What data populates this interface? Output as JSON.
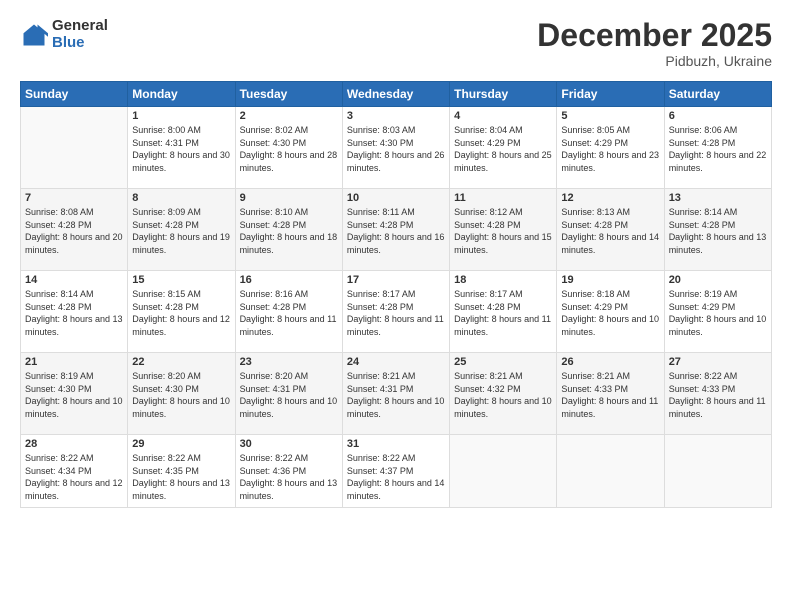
{
  "logo": {
    "general": "General",
    "blue": "Blue"
  },
  "title": "December 2025",
  "subtitle": "Pidbuzh, Ukraine",
  "weekdays": [
    "Sunday",
    "Monday",
    "Tuesday",
    "Wednesday",
    "Thursday",
    "Friday",
    "Saturday"
  ],
  "weeks": [
    [
      {
        "day": "",
        "sunrise": "",
        "sunset": "",
        "daylight": ""
      },
      {
        "day": "1",
        "sunrise": "Sunrise: 8:00 AM",
        "sunset": "Sunset: 4:31 PM",
        "daylight": "Daylight: 8 hours and 30 minutes."
      },
      {
        "day": "2",
        "sunrise": "Sunrise: 8:02 AM",
        "sunset": "Sunset: 4:30 PM",
        "daylight": "Daylight: 8 hours and 28 minutes."
      },
      {
        "day": "3",
        "sunrise": "Sunrise: 8:03 AM",
        "sunset": "Sunset: 4:30 PM",
        "daylight": "Daylight: 8 hours and 26 minutes."
      },
      {
        "day": "4",
        "sunrise": "Sunrise: 8:04 AM",
        "sunset": "Sunset: 4:29 PM",
        "daylight": "Daylight: 8 hours and 25 minutes."
      },
      {
        "day": "5",
        "sunrise": "Sunrise: 8:05 AM",
        "sunset": "Sunset: 4:29 PM",
        "daylight": "Daylight: 8 hours and 23 minutes."
      },
      {
        "day": "6",
        "sunrise": "Sunrise: 8:06 AM",
        "sunset": "Sunset: 4:28 PM",
        "daylight": "Daylight: 8 hours and 22 minutes."
      }
    ],
    [
      {
        "day": "7",
        "sunrise": "Sunrise: 8:08 AM",
        "sunset": "Sunset: 4:28 PM",
        "daylight": "Daylight: 8 hours and 20 minutes."
      },
      {
        "day": "8",
        "sunrise": "Sunrise: 8:09 AM",
        "sunset": "Sunset: 4:28 PM",
        "daylight": "Daylight: 8 hours and 19 minutes."
      },
      {
        "day": "9",
        "sunrise": "Sunrise: 8:10 AM",
        "sunset": "Sunset: 4:28 PM",
        "daylight": "Daylight: 8 hours and 18 minutes."
      },
      {
        "day": "10",
        "sunrise": "Sunrise: 8:11 AM",
        "sunset": "Sunset: 4:28 PM",
        "daylight": "Daylight: 8 hours and 16 minutes."
      },
      {
        "day": "11",
        "sunrise": "Sunrise: 8:12 AM",
        "sunset": "Sunset: 4:28 PM",
        "daylight": "Daylight: 8 hours and 15 minutes."
      },
      {
        "day": "12",
        "sunrise": "Sunrise: 8:13 AM",
        "sunset": "Sunset: 4:28 PM",
        "daylight": "Daylight: 8 hours and 14 minutes."
      },
      {
        "day": "13",
        "sunrise": "Sunrise: 8:14 AM",
        "sunset": "Sunset: 4:28 PM",
        "daylight": "Daylight: 8 hours and 13 minutes."
      }
    ],
    [
      {
        "day": "14",
        "sunrise": "Sunrise: 8:14 AM",
        "sunset": "Sunset: 4:28 PM",
        "daylight": "Daylight: 8 hours and 13 minutes."
      },
      {
        "day": "15",
        "sunrise": "Sunrise: 8:15 AM",
        "sunset": "Sunset: 4:28 PM",
        "daylight": "Daylight: 8 hours and 12 minutes."
      },
      {
        "day": "16",
        "sunrise": "Sunrise: 8:16 AM",
        "sunset": "Sunset: 4:28 PM",
        "daylight": "Daylight: 8 hours and 11 minutes."
      },
      {
        "day": "17",
        "sunrise": "Sunrise: 8:17 AM",
        "sunset": "Sunset: 4:28 PM",
        "daylight": "Daylight: 8 hours and 11 minutes."
      },
      {
        "day": "18",
        "sunrise": "Sunrise: 8:17 AM",
        "sunset": "Sunset: 4:28 PM",
        "daylight": "Daylight: 8 hours and 11 minutes."
      },
      {
        "day": "19",
        "sunrise": "Sunrise: 8:18 AM",
        "sunset": "Sunset: 4:29 PM",
        "daylight": "Daylight: 8 hours and 10 minutes."
      },
      {
        "day": "20",
        "sunrise": "Sunrise: 8:19 AM",
        "sunset": "Sunset: 4:29 PM",
        "daylight": "Daylight: 8 hours and 10 minutes."
      }
    ],
    [
      {
        "day": "21",
        "sunrise": "Sunrise: 8:19 AM",
        "sunset": "Sunset: 4:30 PM",
        "daylight": "Daylight: 8 hours and 10 minutes."
      },
      {
        "day": "22",
        "sunrise": "Sunrise: 8:20 AM",
        "sunset": "Sunset: 4:30 PM",
        "daylight": "Daylight: 8 hours and 10 minutes."
      },
      {
        "day": "23",
        "sunrise": "Sunrise: 8:20 AM",
        "sunset": "Sunset: 4:31 PM",
        "daylight": "Daylight: 8 hours and 10 minutes."
      },
      {
        "day": "24",
        "sunrise": "Sunrise: 8:21 AM",
        "sunset": "Sunset: 4:31 PM",
        "daylight": "Daylight: 8 hours and 10 minutes."
      },
      {
        "day": "25",
        "sunrise": "Sunrise: 8:21 AM",
        "sunset": "Sunset: 4:32 PM",
        "daylight": "Daylight: 8 hours and 10 minutes."
      },
      {
        "day": "26",
        "sunrise": "Sunrise: 8:21 AM",
        "sunset": "Sunset: 4:33 PM",
        "daylight": "Daylight: 8 hours and 11 minutes."
      },
      {
        "day": "27",
        "sunrise": "Sunrise: 8:22 AM",
        "sunset": "Sunset: 4:33 PM",
        "daylight": "Daylight: 8 hours and 11 minutes."
      }
    ],
    [
      {
        "day": "28",
        "sunrise": "Sunrise: 8:22 AM",
        "sunset": "Sunset: 4:34 PM",
        "daylight": "Daylight: 8 hours and 12 minutes."
      },
      {
        "day": "29",
        "sunrise": "Sunrise: 8:22 AM",
        "sunset": "Sunset: 4:35 PM",
        "daylight": "Daylight: 8 hours and 13 minutes."
      },
      {
        "day": "30",
        "sunrise": "Sunrise: 8:22 AM",
        "sunset": "Sunset: 4:36 PM",
        "daylight": "Daylight: 8 hours and 13 minutes."
      },
      {
        "day": "31",
        "sunrise": "Sunrise: 8:22 AM",
        "sunset": "Sunset: 4:37 PM",
        "daylight": "Daylight: 8 hours and 14 minutes."
      },
      {
        "day": "",
        "sunrise": "",
        "sunset": "",
        "daylight": ""
      },
      {
        "day": "",
        "sunrise": "",
        "sunset": "",
        "daylight": ""
      },
      {
        "day": "",
        "sunrise": "",
        "sunset": "",
        "daylight": ""
      }
    ]
  ]
}
